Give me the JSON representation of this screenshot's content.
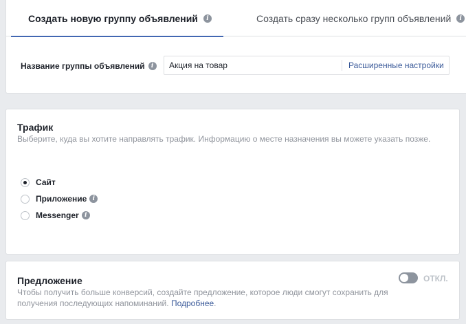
{
  "tabs": [
    {
      "label": "Создать новую группу объявлений",
      "active": true
    },
    {
      "label": "Создать сразу несколько групп объявлений",
      "active": false
    }
  ],
  "adset_name": {
    "label": "Название группы объявлений",
    "value": "Акция на товар",
    "advanced_link": "Расширенные настройки"
  },
  "traffic": {
    "title": "Трафик",
    "subtitle": "Выберите, куда вы хотите направлять трафик. Информацию о месте назначения вы можете указать позже.",
    "options": [
      {
        "label": "Сайт",
        "checked": true
      },
      {
        "label": "Приложение",
        "checked": false
      },
      {
        "label": "Messenger",
        "checked": false
      }
    ]
  },
  "offer": {
    "title": "Предложение",
    "description": "Чтобы получить больше конверсий, создайте предложение, которое люди смогут сохранить для получения последующих напоминаний.",
    "link": "Подробнее",
    "link_suffix": ".",
    "toggle_state": "ОТКЛ."
  },
  "colors": {
    "accent": "#4267b2",
    "link": "#385898",
    "muted": "#90949c",
    "background": "#e9ebee"
  },
  "icons": [
    "info-icon",
    "radio-icon",
    "toggle-icon"
  ]
}
